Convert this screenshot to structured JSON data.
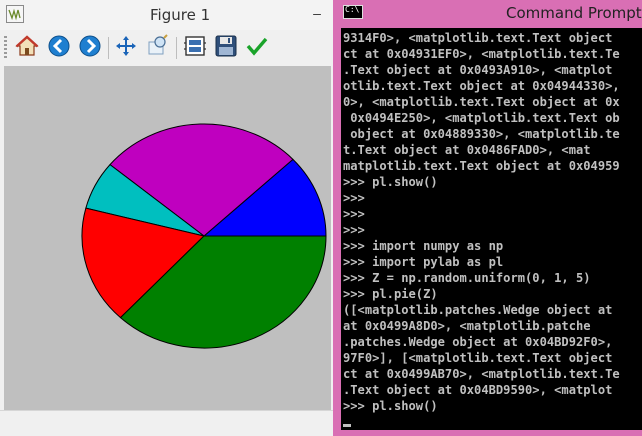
{
  "figure_window": {
    "title": "Figure 1",
    "minimize_glyph": "–",
    "toolbar": [
      {
        "name": "home-button",
        "icon": "home-icon"
      },
      {
        "name": "back-button",
        "icon": "back-arrow-icon"
      },
      {
        "name": "forward-button",
        "icon": "forward-arrow-icon"
      },
      {
        "name": "pan-button",
        "icon": "pan-arrows-icon"
      },
      {
        "name": "zoom-button",
        "icon": "zoom-icon"
      },
      {
        "name": "subplots-button",
        "icon": "subplots-icon"
      },
      {
        "name": "save-button",
        "icon": "floppy-disk-icon"
      },
      {
        "name": "edit-parameters-button",
        "icon": "checkmark-icon"
      }
    ]
  },
  "chart_data": {
    "type": "pie",
    "title": "",
    "slices": [
      {
        "value": 0.12,
        "color": "#0000ff"
      },
      {
        "value": 0.27,
        "color": "#bf00bf"
      },
      {
        "value": 0.07,
        "color": "#00bfbf"
      },
      {
        "value": 0.17,
        "color": "#ff0000"
      },
      {
        "value": 0.37,
        "color": "#008000"
      }
    ],
    "background": "#bfbfbf"
  },
  "cmd_window": {
    "title": "Command Prompt -",
    "icon_text": "C:\\",
    "lines": [
      "9314F0>, <matplotlib.text.Text object",
      "ct at 0x04931EF0>, <matplotlib.text.Te",
      ".Text object at 0x0493A910>, <matplot",
      "otlib.text.Text object at 0x04944330>,",
      "0>, <matplotlib.text.Text object at 0x",
      " 0x0494E250>, <matplotlib.text.Text ob",
      " object at 0x04889330>, <matplotlib.te",
      "t.Text object at 0x0486FAD0>, <mat",
      "matplotlib.text.Text object at 0x04959",
      ">>> pl.show()",
      ">>>",
      ">>>",
      ">>>",
      ">>> import numpy as np",
      ">>> import pylab as pl",
      ">>> Z = np.random.uniform(0, 1, 5)",
      ">>> pl.pie(Z)",
      "([<matplotlib.patches.Wedge object at",
      "at 0x0499A8D0>, <matplotlib.patche",
      ".patches.Wedge object at 0x04BD92F0>,",
      "97F0>], [<matplotlib.text.Text object",
      "ct at 0x0499AB70>, <matplotlib.text.Te",
      ".Text object at 0x04BD9590>, <matplot",
      ">>> pl.show()"
    ]
  }
}
